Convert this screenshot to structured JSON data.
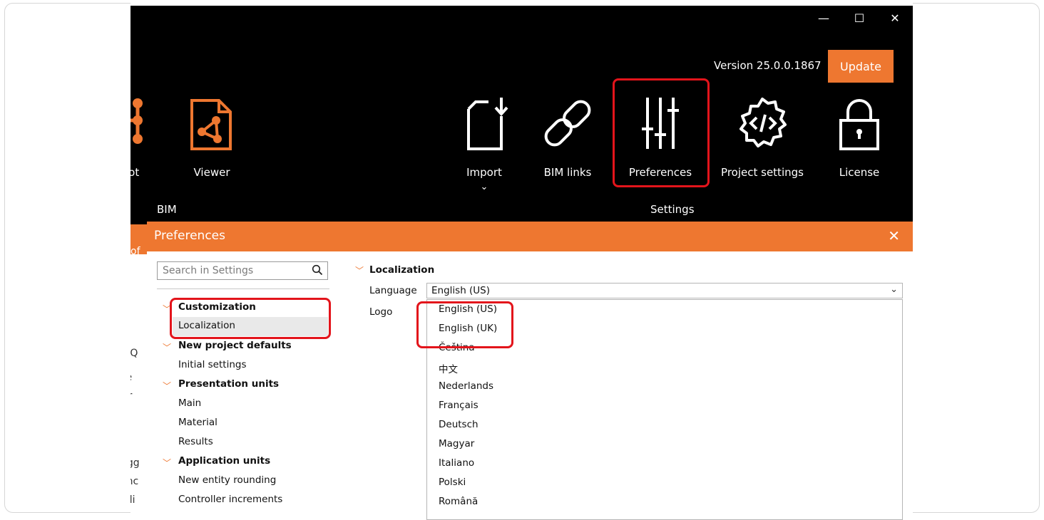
{
  "window": {
    "minimize": "—",
    "maximize": "☐",
    "close": "✕",
    "version": "Version 25.0.0.1867",
    "update_label": "Update"
  },
  "ribbon": {
    "tools": [
      {
        "label": "tbot",
        "icon": "tree-icon"
      },
      {
        "label": "Viewer",
        "icon": "viewer-icon"
      },
      {
        "label": "Import",
        "icon": "import-icon"
      },
      {
        "label": "BIM links",
        "icon": "link-icon"
      },
      {
        "label": "Preferences",
        "icon": "sliders-icon"
      },
      {
        "label": "Project settings",
        "icon": "code-gear-icon"
      },
      {
        "label": "License",
        "icon": "lock-icon"
      }
    ],
    "import_chevron": "⌄",
    "sections": {
      "bim": "BIM",
      "settings": "Settings"
    }
  },
  "background_text": {
    "strip": "of",
    "line1": "d Q",
    "line2": "re",
    "line3": "er",
    "line4": "ugg",
    "line5": "anc",
    "line6": "bili"
  },
  "dialog": {
    "title": "Preferences",
    "close": "✕",
    "search_placeholder": "Search in Settings",
    "tree": [
      {
        "type": "cat",
        "label": "Customization"
      },
      {
        "type": "sub",
        "label": "Localization",
        "selected": true
      },
      {
        "type": "cat",
        "label": "New project defaults"
      },
      {
        "type": "sub",
        "label": "Initial settings"
      },
      {
        "type": "cat",
        "label": "Presentation units"
      },
      {
        "type": "sub",
        "label": "Main"
      },
      {
        "type": "sub",
        "label": "Material"
      },
      {
        "type": "sub",
        "label": "Results"
      },
      {
        "type": "cat",
        "label": "Application units"
      },
      {
        "type": "sub",
        "label": "New entity rounding"
      },
      {
        "type": "sub",
        "label": "Controller increments"
      }
    ],
    "section_title": "Localization",
    "language_label": "Language",
    "logo_label": "Logo",
    "language_value": "English (US)",
    "language_options": [
      "English (US)",
      "English (UK)",
      "Čeština",
      "中文",
      "Nederlands",
      "Français",
      "Deutsch",
      "Magyar",
      "Italiano",
      "Polski",
      "Română"
    ]
  },
  "colors": {
    "accent": "#ee7730",
    "highlight": "#e3141b",
    "topbar": "#000000"
  }
}
